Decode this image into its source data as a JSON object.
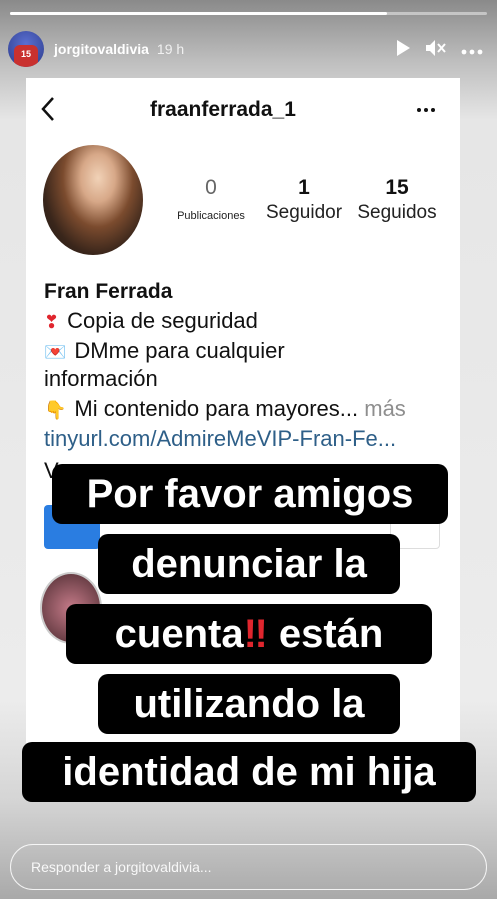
{
  "story": {
    "progress": 0.79,
    "username": "jorgitovaldivia",
    "time": "19 h",
    "avatar_number": "15",
    "reply_placeholder": "Responder a jorgitovaldivia..."
  },
  "profile": {
    "username": "fraanferrada_1",
    "stats": [
      {
        "value": "0",
        "label": "Publicaciones"
      },
      {
        "value": "1",
        "label": "Seguidor"
      },
      {
        "value": "15",
        "label": "Seguidos"
      }
    ],
    "name": "Fran Ferrada",
    "bio": [
      {
        "icon": "exclamation-icon",
        "glyph": "❣",
        "text": "Copia de seguridad"
      },
      {
        "icon": "envelope-heart-icon",
        "glyph": "💌",
        "text": "DMme para cualquier"
      },
      {
        "icon": "",
        "glyph": "",
        "text": "información"
      },
      {
        "icon": "pointing-down-icon",
        "glyph": "👇",
        "text": "Mi contenido para mayores...",
        "more": "más"
      }
    ],
    "link": "tinyurl.com/AdmireMeVIP-Fran-Fe...",
    "partial_line": "V"
  },
  "overlay": {
    "line1": "Por favor amigos",
    "line2": "denunciar la",
    "line3_a": "cuenta",
    "line3_emoji": "‼",
    "line3_b": " están",
    "line4": "utilizando la",
    "line5": "identidad de mi hija"
  },
  "colors": {
    "link": "#2e5f88",
    "emoji_red": "#e0262e",
    "button_blue": "#2a7de1"
  }
}
